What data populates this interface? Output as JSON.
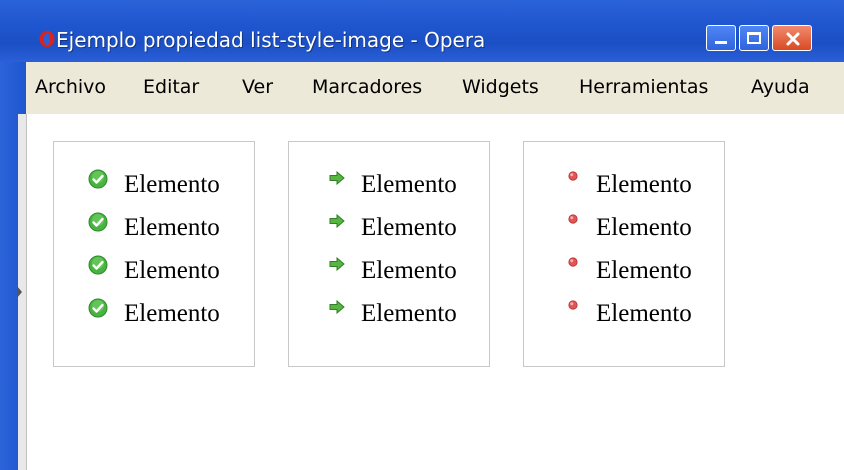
{
  "window": {
    "title": "Ejemplo propiedad list-style-image - Opera"
  },
  "menu": {
    "items": [
      {
        "label": "Archivo"
      },
      {
        "label": "Editar"
      },
      {
        "label": "Ver"
      },
      {
        "label": "Marcadores"
      },
      {
        "label": "Widgets"
      },
      {
        "label": "Herramientas"
      },
      {
        "label": "Ayuda"
      }
    ]
  },
  "lists": [
    {
      "marker_icon": "green-check-circle-icon",
      "marker_color": "#3fae3a",
      "items": [
        "Elemento",
        "Elemento",
        "Elemento",
        "Elemento"
      ]
    },
    {
      "marker_icon": "green-arrow-right-icon",
      "marker_color": "#4aa83b",
      "items": [
        "Elemento",
        "Elemento",
        "Elemento",
        "Elemento"
      ]
    },
    {
      "marker_icon": "red-dot-icon",
      "marker_color": "#e04a4a",
      "items": [
        "Elemento",
        "Elemento",
        "Elemento",
        "Elemento"
      ]
    }
  ]
}
